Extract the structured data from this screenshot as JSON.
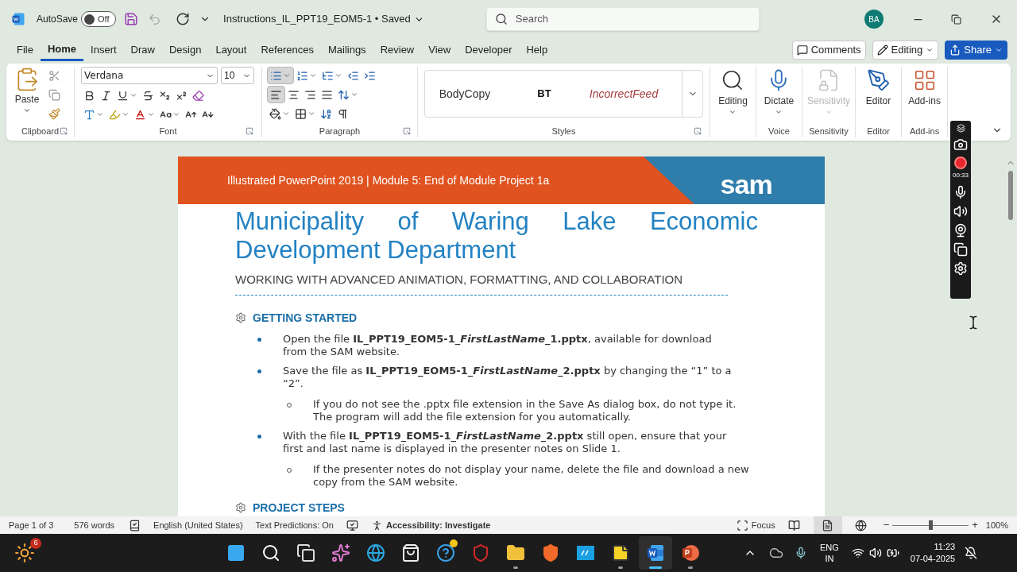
{
  "title_bar": {
    "autosave_label": "AutoSave",
    "autosave": {
      "on": false,
      "label": "Off"
    },
    "document_title": "Instructions_IL_PPT19_EOM5-1 • Saved",
    "search_placeholder": "Search",
    "avatar": "BA"
  },
  "menu_tabs": [
    {
      "label": "File",
      "selected": false
    },
    {
      "label": "Home",
      "selected": true
    },
    {
      "label": "Insert",
      "selected": false
    },
    {
      "label": "Draw",
      "selected": false
    },
    {
      "label": "Design",
      "selected": false
    },
    {
      "label": "Layout",
      "selected": false
    },
    {
      "label": "References",
      "selected": false
    },
    {
      "label": "Mailings",
      "selected": false
    },
    {
      "label": "Review",
      "selected": false
    },
    {
      "label": "View",
      "selected": false
    },
    {
      "label": "Developer",
      "selected": false
    },
    {
      "label": "Help",
      "selected": false
    }
  ],
  "header_buttons": {
    "comments": "Comments",
    "editing": "Editing",
    "share": "Share"
  },
  "ribbon": {
    "clipboard": {
      "paste": "Paste",
      "label": "Clipboard"
    },
    "font": {
      "name": "Verdana",
      "size": "10",
      "label": "Font"
    },
    "paragraph": {
      "label": "Paragraph",
      "bullets": true,
      "alignments": [
        {
          "kind": "left",
          "selected": true
        },
        {
          "kind": "center",
          "selected": false
        },
        {
          "kind": "right",
          "selected": false
        },
        {
          "kind": "justify",
          "selected": false
        }
      ]
    },
    "styles": {
      "label": "Styles",
      "items": [
        {
          "label": "BodyCopy",
          "kind": "plain"
        },
        {
          "label": "BT",
          "kind": "bold"
        },
        {
          "label": "IncorrectFeed",
          "kind": "feedback"
        }
      ]
    },
    "tools": [
      {
        "kind": "editing",
        "label": "Editing",
        "disabled": false
      },
      {
        "kind": "dictate",
        "label": "Dictate",
        "group": "Voice",
        "disabled": false
      },
      {
        "kind": "sensitivity",
        "label": "Sensitivity",
        "group": "Sensitivity",
        "disabled": true
      },
      {
        "kind": "editor",
        "label": "Editor",
        "group": "Editor",
        "disabled": false
      },
      {
        "kind": "addins",
        "label": "Add-ins",
        "group": "Add-ins",
        "disabled": false
      }
    ]
  },
  "recorder": {
    "time": "00:33"
  },
  "document": {
    "banner": "Illustrated PowerPoint 2019 | Module 5: End of Module Project 1a",
    "logo": "sam",
    "title": "Municipality of Waring Lake Economic Development Department",
    "subtitle": "WORKING WITH ADVANCED ANIMATION, FORMATTING, AND COLLABORATION",
    "sections": [
      {
        "heading": "GETTING STARTED",
        "items": [
          {
            "segments": [
              "Open the file **IL_PPT19_EOM5-1_**",
              "*FirstLastName*",
              "**_1.pptx**, available for download from the SAM website."
            ]
          },
          {
            "segments": [
              "Save the file as **IL_PPT19_EOM5-1_**",
              "*FirstLastName*",
              "**_2.pptx** by changing the “1” to a “2”."
            ],
            "children": [
              {
                "text": "If you do not see the .pptx file extension in the Save As dialog box, do not type it. The program will add the file extension for you automatically."
              }
            ]
          },
          {
            "segments": [
              "With the file **IL_PPT19_EOM5-1_**",
              "*FirstLastName*",
              "**_2.pptx** still open, ensure that your first and last name is displayed in the presenter notes on Slide 1."
            ],
            "children": [
              {
                "text": "If the presenter notes do not display your name, delete the file and download a new copy from the SAM website."
              }
            ]
          }
        ]
      },
      {
        "heading": "PROJECT STEPS"
      }
    ]
  },
  "status_bar": {
    "page": "Page 1 of 3",
    "words": "576 words",
    "language": "English (United States)",
    "predictions": "Text Predictions: On",
    "accessibility": "Accessibility: Investigate",
    "focus": "Focus",
    "views": [
      {
        "kind": "read",
        "selected": false
      },
      {
        "kind": "print",
        "selected": true
      },
      {
        "kind": "web",
        "selected": false
      }
    ],
    "zoom": {
      "level": 0.5,
      "out": "−",
      "in": "+",
      "label": "100%"
    }
  },
  "taskbar": {
    "weather_badge": "6",
    "apps": [
      {
        "kind": "start",
        "open": false,
        "active": false
      },
      {
        "kind": "search",
        "open": false,
        "active": false
      },
      {
        "kind": "taskview",
        "open": false,
        "active": false
      },
      {
        "kind": "copilot",
        "open": false,
        "active": false
      },
      {
        "kind": "edge",
        "open": false,
        "active": false
      },
      {
        "kind": "store",
        "open": false,
        "active": false
      },
      {
        "kind": "help",
        "open": false,
        "active": false
      },
      {
        "kind": "mcafee",
        "open": false,
        "active": false
      },
      {
        "kind": "explorer",
        "open": true,
        "active": false
      },
      {
        "kind": "brave",
        "open": false,
        "active": false
      },
      {
        "kind": "myhp",
        "open": false,
        "active": false
      },
      {
        "kind": "sticky",
        "open": true,
        "active": false
      },
      {
        "kind": "word",
        "open": true,
        "active": true
      },
      {
        "kind": "powerpoint",
        "open": true,
        "active": false
      }
    ],
    "tray": {
      "language": "ENG",
      "region": "IN",
      "time": "11:23",
      "date": "07-04-2025"
    }
  }
}
